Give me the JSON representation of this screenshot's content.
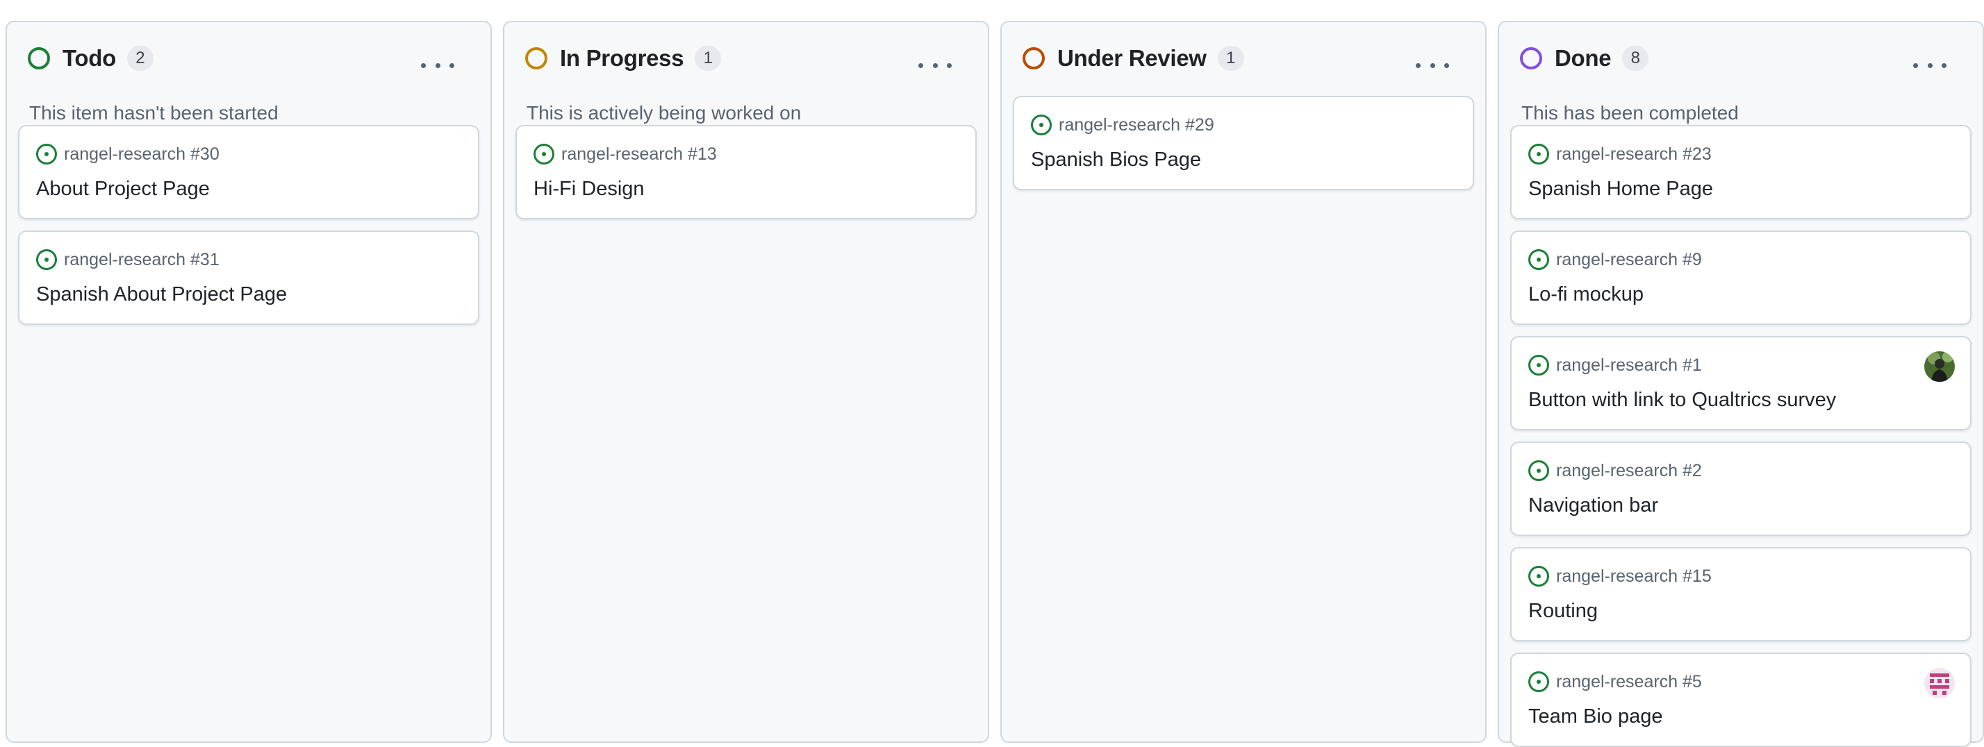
{
  "columns": [
    {
      "title": "Todo",
      "count": "2",
      "description": "This item hasn't been started",
      "status_color": "#1a7f37",
      "menu_icon": "kebab-horizontal-icon",
      "cards": [
        {
          "ref": "rangel-research #30",
          "title": "About Project Page",
          "icon": "issue-opened-icon"
        },
        {
          "ref": "rangel-research #31",
          "title": "Spanish About Project Page",
          "icon": "issue-opened-icon"
        }
      ]
    },
    {
      "title": "In Progress",
      "count": "1",
      "description": "This is actively being worked on",
      "status_color": "#bf8700",
      "menu_icon": "kebab-horizontal-icon",
      "cards": [
        {
          "ref": "rangel-research #13",
          "title": "Hi-Fi Design",
          "icon": "issue-opened-icon"
        }
      ]
    },
    {
      "title": "Under Review",
      "count": "1",
      "description": "",
      "status_color": "#bc4c00",
      "menu_icon": "kebab-horizontal-icon",
      "cards": [
        {
          "ref": "rangel-research #29",
          "title": "Spanish Bios Page",
          "icon": "issue-opened-icon"
        }
      ]
    },
    {
      "title": "Done",
      "count": "8",
      "description": "This has been completed",
      "status_color": "#8250df",
      "menu_icon": "kebab-horizontal-icon",
      "cards": [
        {
          "ref": "rangel-research #23",
          "title": "Spanish Home Page",
          "icon": "issue-opened-icon"
        },
        {
          "ref": "rangel-research #9",
          "title": "Lo-fi mockup",
          "icon": "issue-opened-icon"
        },
        {
          "ref": "rangel-research #1",
          "title": "Button with link to Qualtrics survey",
          "icon": "issue-opened-icon",
          "avatar": "user-avatar-photo"
        },
        {
          "ref": "rangel-research #2",
          "title": "Navigation bar",
          "icon": "issue-opened-icon"
        },
        {
          "ref": "rangel-research #15",
          "title": "Routing",
          "icon": "issue-opened-icon"
        },
        {
          "ref": "rangel-research #5",
          "title": "Team Bio page",
          "icon": "issue-opened-icon",
          "avatar": "user-avatar-identicon"
        }
      ]
    }
  ],
  "colors": {
    "issue_open": "#1a7f37",
    "column_bg": "#f6f8fa",
    "border": "#d0d7de"
  }
}
